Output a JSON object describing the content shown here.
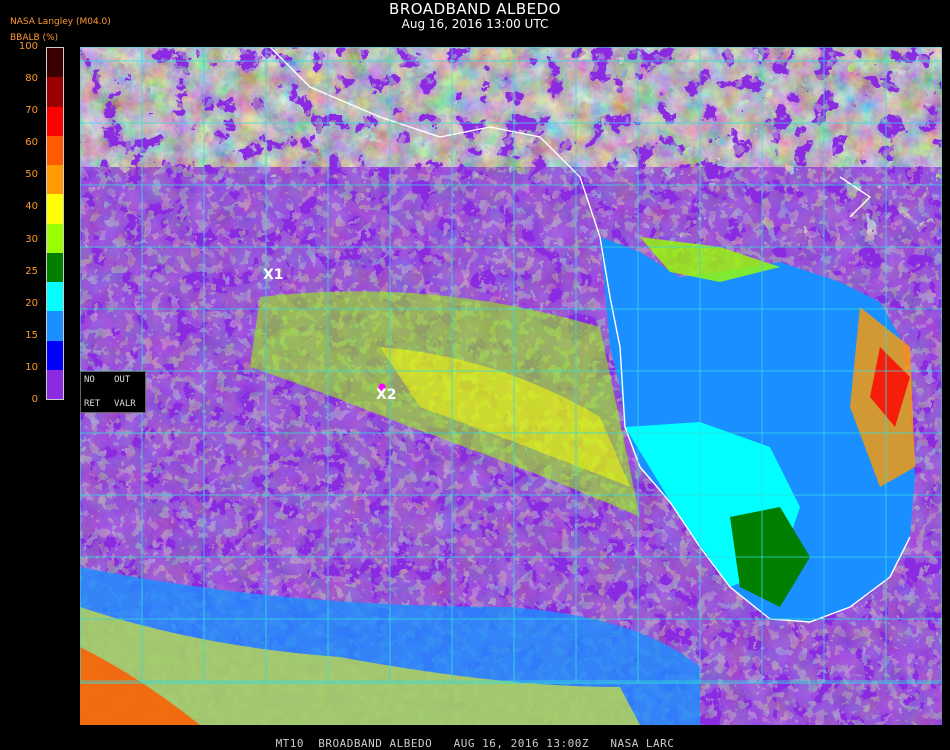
{
  "header": {
    "title": "BROADBAND ALBEDO",
    "subtitle": "Aug 16, 2016 13:00 UTC",
    "source": "NASA Langley (M04.0)"
  },
  "colorbar": {
    "unit_label": "BBALB (%)",
    "ticks": [
      "100",
      "80",
      "70",
      "60",
      "50",
      "40",
      "30",
      "25",
      "20",
      "15",
      "10",
      "0"
    ],
    "colors": [
      "#3a0000",
      "#9b0000",
      "#ff0000",
      "#ff5a00",
      "#ff9a00",
      "#ffff00",
      "#99ff00",
      "#007f00",
      "#00ffff",
      "#1a8fff",
      "#0000ff",
      "#8a2be2"
    ]
  },
  "controls": {
    "no_label": "NO",
    "out_label": "OUT",
    "ret_label": "RET",
    "valr_label": "VALR"
  },
  "markers": [
    {
      "label": "X1",
      "color": "#ff00ff"
    },
    {
      "label": "X2",
      "color": "#ff00ff"
    }
  ],
  "footer": {
    "text": "MT10  BROADBAND ALBEDO   AUG 16, 2016 13:00Z   NASA LARC"
  },
  "colors": {
    "ocean": "#8a2be2",
    "grid": "#33dddd",
    "coast": "#ffffff"
  }
}
